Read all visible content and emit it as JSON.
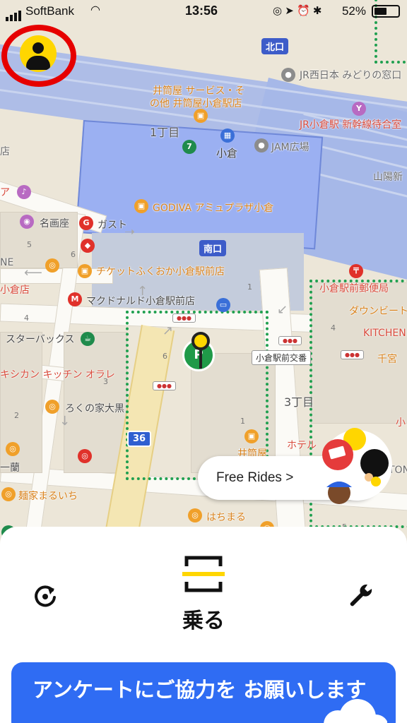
{
  "status_bar": {
    "carrier": "SoftBank",
    "time": "13:56",
    "battery": "52%",
    "battery_level": 0.52
  },
  "map": {
    "labels": {
      "kitaguchi": "北口",
      "minaminoguchi": "南口",
      "jr_midori": "JR西日本 みどりの窓口",
      "izutsuya_service": "井筒屋 サービス・そ",
      "izutsuya_service2": "の他 井筒屋小倉駅店",
      "jr_shinkansen": "JR小倉駅 新幹線待合室",
      "itchome": "1丁目",
      "kokura": "小倉",
      "jam": "JAM広場",
      "sanyo": "山陽新",
      "godiva": "GODIVA アミュプラザ小倉",
      "meigaza": "名画座",
      "gusto": "ガスト",
      "ticket": "チケットふくおか小倉駅前店",
      "mcdonalds": "マクドナルド小倉駅前店",
      "post_office": "小倉駅前郵便局",
      "downbeat": "ダウンビート",
      "kitchen": "KITCHEN",
      "senko": "千宮",
      "starbucks": "スターバックス",
      "koban": "小倉駅前交番",
      "kitchen_orare": "キシカン キッチン オラレ",
      "rokunoie": "ろくの家大黒",
      "sanchome": "3丁目",
      "hotel": "ホテル",
      "ichiran": "一蘭",
      "menya": "麺家まるいち",
      "hachimaru": "はちまる",
      "izutsuya_small": "井筒屋",
      "tenten": "店",
      "hsa": "ア",
      "ashiten": "小倉店",
      "ne": "NE",
      "ikotani": "井筒",
      "route36": "36",
      "tonc": "TONC",
      "shou": "小"
    }
  },
  "promo": {
    "free_rides_label": "Free Rides >"
  },
  "bottom_sheet": {
    "scan_label": "乗る",
    "survey_text": "アンケートにご協力を お願いします"
  },
  "colors": {
    "accent_yellow": "#ffd600",
    "zone_green": "#20a050",
    "survey_blue": "#2f6cf3",
    "profile_highlight_red": "#e60000"
  },
  "icons": {
    "profile": "user-avatar-icon",
    "refresh": "refresh-icon",
    "settings": "wrench-icon",
    "scan": "scan-frame-icon",
    "pin": "bike-pin-icon"
  }
}
